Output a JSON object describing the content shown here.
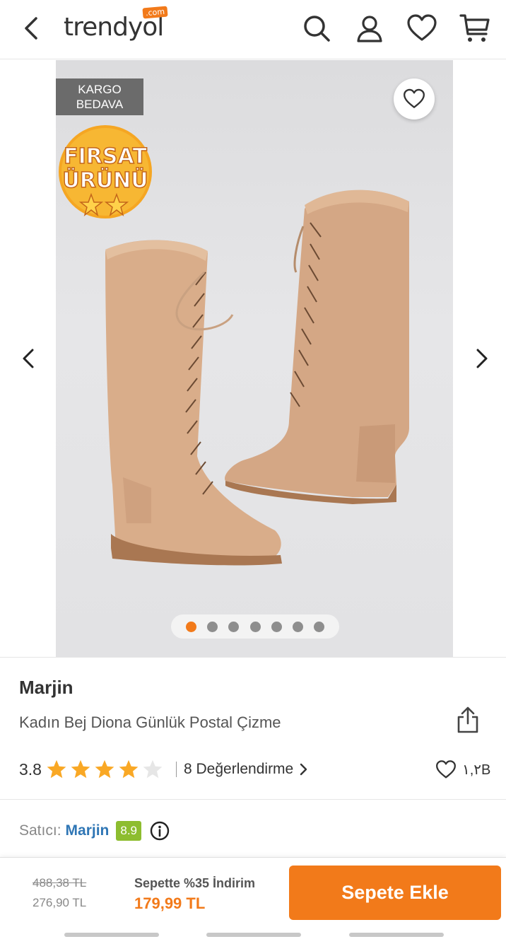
{
  "header": {
    "logo_text": "trendyol",
    "logo_badge": ".com",
    "icons": [
      "back-icon",
      "search-icon",
      "user-icon",
      "heart-icon",
      "cart-icon"
    ]
  },
  "gallery": {
    "badge_kargo_line1": "KARGO",
    "badge_kargo_line2": "BEDAVA",
    "firsat_line1": "FIRSAT",
    "firsat_line2": "ÜRÜNÜ",
    "image_count": 7,
    "active_index": 0
  },
  "product": {
    "brand": "Marjin",
    "name": "Kadın Bej Diona Günlük Postal Çizme",
    "rating": "3.8",
    "rating_value": 3.8,
    "reviews_label": "8 Değerlendirme",
    "favorites": "١,٢B"
  },
  "seller": {
    "label": "Satıcı:",
    "name": "Marjin",
    "score": "8.9"
  },
  "pricing": {
    "old_price": "488,38 TL",
    "current_price": "276,90 TL",
    "discount_label": "Sepette %35 İndirim",
    "discount_price": "179,99 TL",
    "add_to_cart": "Sepete Ekle"
  },
  "colors": {
    "accent": "#f27a1a",
    "star": "#f9a825",
    "seller_link": "#2f76b5",
    "score_badge": "#8dbd2f"
  }
}
